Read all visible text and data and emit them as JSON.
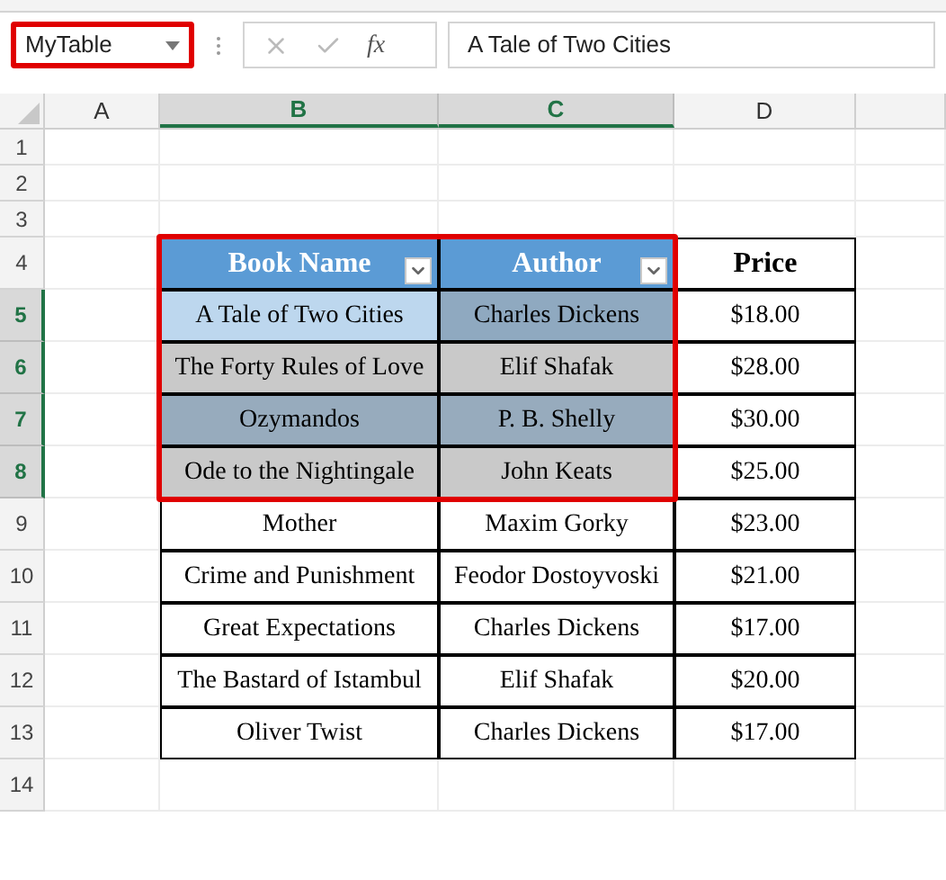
{
  "name_box": {
    "value": "MyTable",
    "highlighted": true
  },
  "formula_bar": {
    "function_label": "fx",
    "value": "A Tale of Two Cities"
  },
  "columns": [
    {
      "label": "A",
      "selected": false
    },
    {
      "label": "B",
      "selected": true
    },
    {
      "label": "C",
      "selected": true
    },
    {
      "label": "D",
      "selected": false
    }
  ],
  "rows": [
    {
      "label": "1",
      "selected": false
    },
    {
      "label": "2",
      "selected": false
    },
    {
      "label": "3",
      "selected": false
    },
    {
      "label": "4",
      "selected": false
    },
    {
      "label": "5",
      "selected": true
    },
    {
      "label": "6",
      "selected": true
    },
    {
      "label": "7",
      "selected": true
    },
    {
      "label": "8",
      "selected": true
    },
    {
      "label": "9",
      "selected": false
    },
    {
      "label": "10",
      "selected": false
    },
    {
      "label": "11",
      "selected": false
    },
    {
      "label": "12",
      "selected": false
    },
    {
      "label": "13",
      "selected": false
    },
    {
      "label": "14",
      "selected": false
    }
  ],
  "table": {
    "highlighted": true,
    "columns": [
      {
        "label": "Book Name",
        "filter": true
      },
      {
        "label": "Author",
        "filter": true
      },
      {
        "label": "Price",
        "filter": false
      }
    ],
    "rows": [
      [
        {
          "text": "A Tale of Two Cities",
          "color": "#bdd7ee"
        },
        {
          "text": "Charles Dickens",
          "color": "#8fa9c0"
        },
        {
          "text": "$18.00"
        }
      ],
      [
        {
          "text": "The Forty Rules of Love",
          "color": "#c9c9c9"
        },
        {
          "text": "Elif Shafak",
          "color": "#c9c9c9"
        },
        {
          "text": "$28.00"
        }
      ],
      [
        {
          "text": "Ozymandos",
          "color": "#97abbd"
        },
        {
          "text": "P. B. Shelly",
          "color": "#97abbd"
        },
        {
          "text": "$30.00"
        }
      ],
      [
        {
          "text": "Ode to the Nightingale",
          "color": "#c9c9c9"
        },
        {
          "text": "John Keats",
          "color": "#c9c9c9"
        },
        {
          "text": "$25.00"
        }
      ],
      [
        {
          "text": "Mother"
        },
        {
          "text": "Maxim Gorky"
        },
        {
          "text": "$23.00"
        }
      ],
      [
        {
          "text": "Crime and Punishment"
        },
        {
          "text": "Feodor Dostoyvoski"
        },
        {
          "text": "$21.00"
        }
      ],
      [
        {
          "text": "Great Expectations"
        },
        {
          "text": "Charles Dickens"
        },
        {
          "text": "$17.00"
        }
      ],
      [
        {
          "text": "The Bastard of Istambul"
        },
        {
          "text": "Elif Shafak"
        },
        {
          "text": "$20.00"
        }
      ],
      [
        {
          "text": "Oliver Twist"
        },
        {
          "text": "Charles Dickens"
        },
        {
          "text": "$17.00"
        }
      ]
    ]
  }
}
